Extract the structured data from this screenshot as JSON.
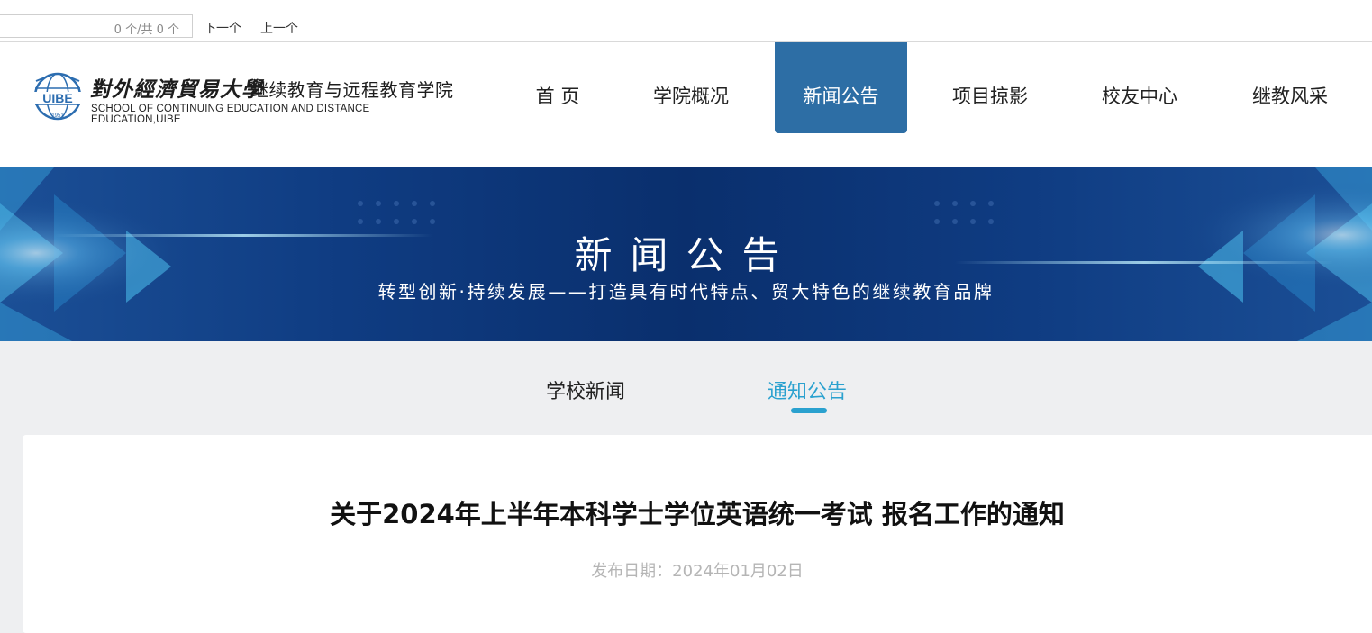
{
  "find_bar": {
    "count_text": "0 个/共 0 个",
    "next_label": "下一个",
    "prev_label": "上一个"
  },
  "header": {
    "logo": {
      "emblem_text": "UIBE",
      "emblem_year": "1951",
      "calligraphy_name": "對外經濟貿易大學",
      "college_name": "继续教育与远程教育学院",
      "english_name": "SCHOOL OF CONTINUING EDUCATION AND DISTANCE EDUCATION,UIBE"
    },
    "nav": [
      {
        "label": "首 页",
        "active": false
      },
      {
        "label": "学院概况",
        "active": false
      },
      {
        "label": "新闻公告",
        "active": true
      },
      {
        "label": "项目掠影",
        "active": false
      },
      {
        "label": "校友中心",
        "active": false
      },
      {
        "label": "继教风采",
        "active": false
      }
    ]
  },
  "banner": {
    "title": "新闻公告",
    "subtitle": "转型创新·持续发展——打造具有时代特点、贸大特色的继续教育品牌"
  },
  "tabs": [
    {
      "label": "学校新闻",
      "active": false
    },
    {
      "label": "通知公告",
      "active": true
    }
  ],
  "article": {
    "title": "关于2024年上半年本科学士学位英语统一考试 报名工作的通知",
    "date": "发布日期：2024年01月02日"
  },
  "colors": {
    "nav_active_bg": "#2d6ea5",
    "tab_active": "#2aa1cf",
    "banner_dark": "#0a2f6d",
    "page_bg": "#eeeff1"
  }
}
